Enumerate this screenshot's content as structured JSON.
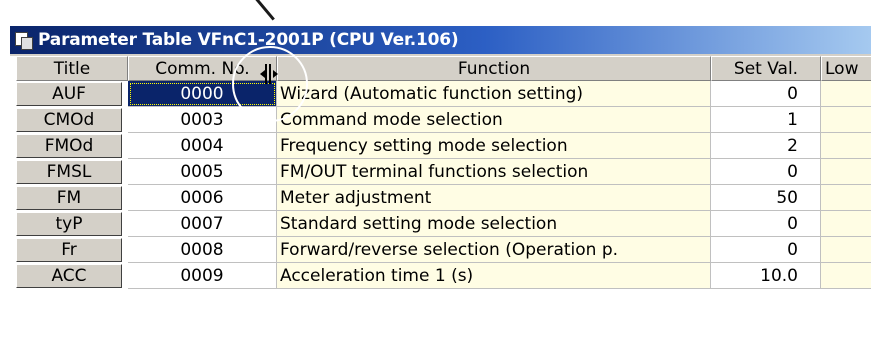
{
  "window": {
    "title": "Parameter Table VFnC1-2001P (CPU Ver.106)",
    "icon": "parameter-table-icon"
  },
  "columns": {
    "title": "Title",
    "comm_no": "Comm. No.",
    "function": "Function",
    "set_val": "Set Val.",
    "low": "Low"
  },
  "rows": [
    {
      "title": "AUF",
      "comm_no": "0000",
      "function": "Wizard (Automatic function setting)",
      "set_val": "0"
    },
    {
      "title": "CMOd",
      "comm_no": "0003",
      "function": "Command mode selection",
      "set_val": "1"
    },
    {
      "title": "FMOd",
      "comm_no": "0004",
      "function": "Frequency setting mode selection",
      "set_val": "2"
    },
    {
      "title": "FMSL",
      "comm_no": "0005",
      "function": "FM/OUT terminal functions selection",
      "set_val": "0"
    },
    {
      "title": "FM",
      "comm_no": "0006",
      "function": "Meter adjustment",
      "set_val": "50"
    },
    {
      "title": "tyP",
      "comm_no": "0007",
      "function": "Standard setting mode selection",
      "set_val": "0"
    },
    {
      "title": "Fr",
      "comm_no": "0008",
      "function": "Forward/reverse selection (Operation p.",
      "set_val": "0"
    },
    {
      "title": "ACC",
      "comm_no": "0009",
      "function": "Acceleration time 1 (s)",
      "set_val": "10.0"
    }
  ],
  "colors": {
    "title_bar_start": "#0a246a",
    "selection": "#0a246a",
    "function_bg": "#fffde4"
  }
}
